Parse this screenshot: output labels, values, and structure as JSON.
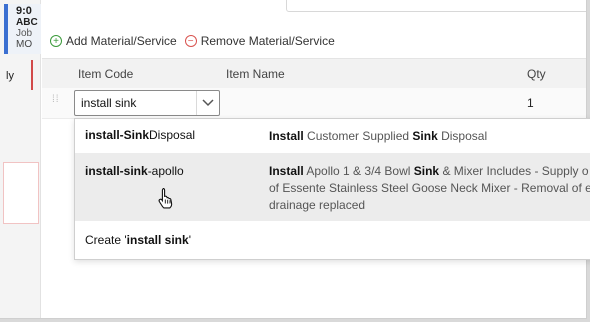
{
  "background_card": {
    "time": "9:0",
    "abc": "ABC",
    "job": "Job",
    "mo": "MO",
    "side_text": "ly"
  },
  "toolbar": {
    "add_label": "Add Material/Service",
    "remove_label": "Remove Material/Service"
  },
  "table": {
    "headers": {
      "item_code": "Item Code",
      "item_name": "Item Name",
      "qty": "Qty"
    },
    "row": {
      "item_code_value": "install sink",
      "qty": "1"
    }
  },
  "dropdown": {
    "options": [
      {
        "code_bold": "install-Sink",
        "code_rest": "Disposal",
        "desc_line1_bold": "Install",
        "desc_line1_mid": " Customer Supplied ",
        "desc_line1_bold2": "Sink",
        "desc_line1_rest": " Disposal"
      },
      {
        "code_bold": "install-sink",
        "code_rest": "-apollo",
        "desc_line1_bold": "Install",
        "desc_line1_mid": " Apollo 1 & 3/4 Bowl ",
        "desc_line1_bold2": "Sink",
        "desc_line1_rest": " & Mixer Includes - Supply o",
        "desc_line2": "of Essente Stainless Steel Goose Neck Mixer - Removal of e",
        "desc_line3": "drainage replaced"
      }
    ],
    "create_prefix": "Create '",
    "create_value": "install sink",
    "create_suffix": "'"
  },
  "colors": {
    "accent": "#3b6fd1",
    "add": "#3a9a3a",
    "remove": "#d9534f"
  },
  "icons": {
    "add": "plus-circle-icon",
    "remove": "minus-circle-icon",
    "chevron": "chevron-down-icon",
    "drag": "drag-handle-icon",
    "cursor": "hand-pointer-icon"
  }
}
